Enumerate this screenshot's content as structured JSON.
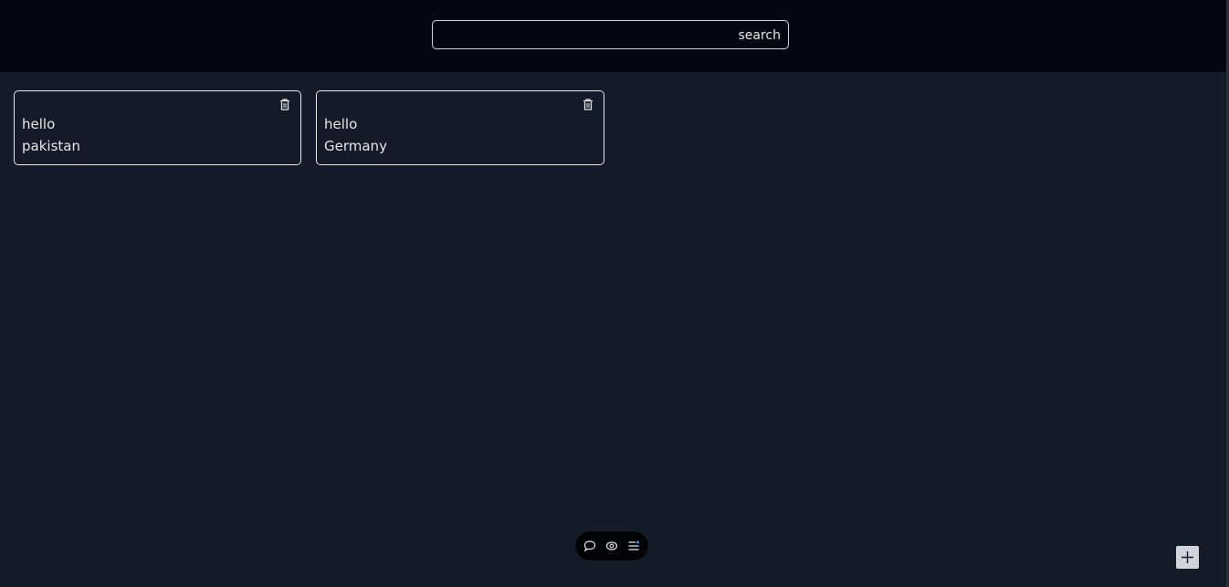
{
  "search": {
    "value": "",
    "placeholder": "",
    "button_label": "search"
  },
  "notes": [
    {
      "title": "hello",
      "body": "pakistan",
      "icon": "trash-icon"
    },
    {
      "title": "hello",
      "body": "Germany",
      "icon": "trash-icon"
    }
  ],
  "toolbar": {
    "icons": [
      "chat-bubble-icon",
      "eye-icon",
      "list-settings-icon"
    ]
  },
  "add_button": {
    "icon": "plus-icon"
  },
  "colors": {
    "background": "#131a28",
    "topbar": "#030712",
    "border": "#e5e7eb",
    "accent": "#3b82f6"
  }
}
